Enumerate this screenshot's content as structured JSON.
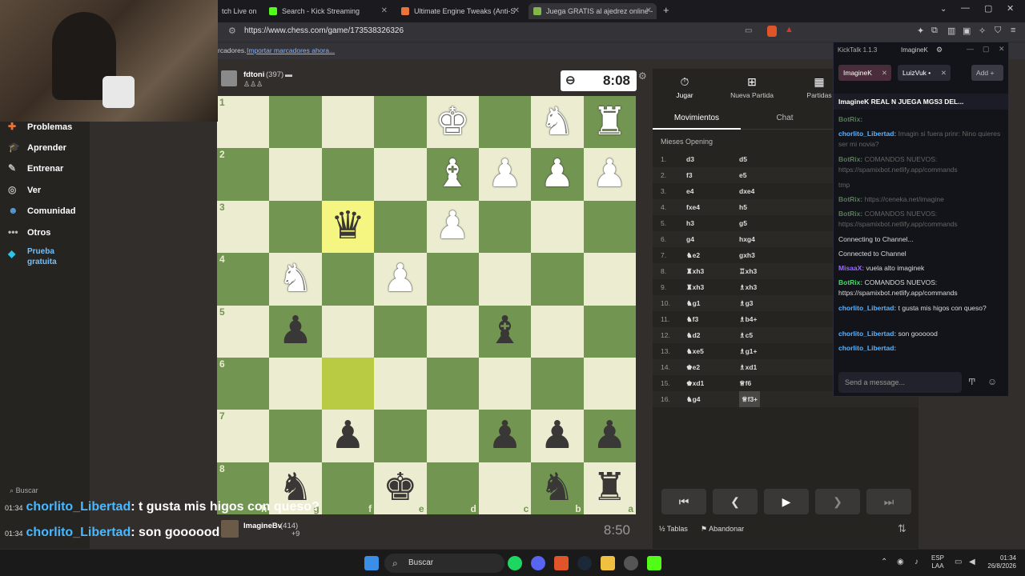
{
  "browser": {
    "tabs": [
      {
        "label": "tch Live on ",
        "active": false
      },
      {
        "label": "Search - Kick Streaming",
        "active": false
      },
      {
        "label": "Ultimate Engine Tweaks (Anti-Stutte",
        "active": false
      },
      {
        "label": "Juega GRATIS al ajedrez online -",
        "active": true
      }
    ],
    "url": "https://www.chess.com/game/173538326326",
    "bookmarks_prefix": "rcadores.",
    "bookmarks_link": "Importar marcadores ahora..."
  },
  "nav": {
    "items": [
      {
        "label": "Problemas",
        "icon": "puzzle-icon"
      },
      {
        "label": "Aprender",
        "icon": "learn-icon"
      },
      {
        "label": "Entrenar",
        "icon": "train-icon"
      },
      {
        "label": "Ver",
        "icon": "binoculars-icon"
      },
      {
        "label": "Comunidad",
        "icon": "community-icon"
      },
      {
        "label": "Otros",
        "icon": "more-icon"
      },
      {
        "label": "Prueba gratuita",
        "icon": "diamond-icon"
      }
    ],
    "search_label": "Buscar"
  },
  "game": {
    "top_player": {
      "name": "fdtoni",
      "rating": "(397)"
    },
    "top_clock": "8:08",
    "bottom_player": {
      "name": "ImagineBv",
      "rating": "(414)",
      "extra": "+9"
    },
    "bottom_clock": "8:50",
    "ranks": [
      "1",
      "2",
      "3",
      "4",
      "5",
      "6",
      "7",
      "8"
    ],
    "files": [
      "h",
      "g",
      "f",
      "e",
      "d",
      "c",
      "b",
      "a"
    ],
    "board": [
      [
        "",
        "",
        "",
        "",
        "wK",
        "",
        "wN",
        "wR"
      ],
      [
        "",
        "",
        "",
        "",
        "wB",
        "wP",
        "wP",
        "wP"
      ],
      [
        "",
        "",
        "bQ",
        "",
        "wP",
        "",
        "",
        ""
      ],
      [
        "",
        "wN",
        "",
        "wP",
        "",
        "",
        "",
        ""
      ],
      [
        "",
        "bP",
        "",
        "",
        "",
        "bB",
        "",
        ""
      ],
      [
        "",
        "",
        "",
        "",
        "",
        "",
        "",
        ""
      ],
      [
        "",
        "",
        "bP",
        "",
        "",
        "bP",
        "bP",
        "bP"
      ],
      [
        "",
        "bN",
        "",
        "bK",
        "",
        "",
        "bN",
        "bR"
      ]
    ]
  },
  "panel": {
    "top_buttons": [
      {
        "label": "Jugar",
        "icon": "stopwatch-icon"
      },
      {
        "label": "Nueva Partida",
        "icon": "plus-icon"
      },
      {
        "label": "Partidas",
        "icon": "board-icon"
      }
    ],
    "tabs": [
      "Movimientos",
      "Chat"
    ],
    "opening": "Mieses Opening",
    "moves": [
      {
        "n": "1.",
        "w": "d3",
        "b": "d5"
      },
      {
        "n": "2.",
        "w": "f3",
        "b": "e5"
      },
      {
        "n": "3.",
        "w": "e4",
        "b": "dxe4"
      },
      {
        "n": "4.",
        "w": "fxe4",
        "b": "h5"
      },
      {
        "n": "5.",
        "w": "h3",
        "b": "g5"
      },
      {
        "n": "6.",
        "w": "g4",
        "b": "hxg4"
      },
      {
        "n": "7.",
        "w": "♞e2",
        "b": "gxh3"
      },
      {
        "n": "8.",
        "w": "♜xh3",
        "b": "♖xh3"
      },
      {
        "n": "9.",
        "w": "♜xh3",
        "b": "♗xh3"
      },
      {
        "n": "10.",
        "w": "♞g1",
        "b": "♗g3"
      },
      {
        "n": "11.",
        "w": "♞f3",
        "b": "♗b4+"
      },
      {
        "n": "12.",
        "w": "♞d2",
        "b": "♗c5"
      },
      {
        "n": "13.",
        "w": "♞xe5",
        "b": "♗g1+"
      },
      {
        "n": "14.",
        "w": "♚e2",
        "b": "♗xd1"
      },
      {
        "n": "15.",
        "w": "♚xd1",
        "b": "♕f6"
      },
      {
        "n": "16.",
        "w": "♞g4",
        "b": "♕f3+"
      }
    ],
    "bottom_actions": [
      "Tablas",
      "Abandonar"
    ]
  },
  "kicktalk": {
    "title": "KickTalk 1.1.3",
    "user": "ImagineK",
    "channels": [
      "ImagineK",
      "LuizVuk •"
    ],
    "add_label": "Add",
    "header": "ImagineK   REAL N JUEGA MGS3 DEL...",
    "messages": [
      {
        "user": "BotRix:",
        "text": "",
        "dim": true
      },
      {
        "user": "chorlito_Libertad:",
        "text": "Imagin si fuera prinr: Nino quieres ser mi novia? ",
        "dim": true
      },
      {
        "user": "BotRix:",
        "text": "COMANDOS NUEVOS: https://spamixbot.netlify.app/commands",
        "dim": true
      },
      {
        "user": "",
        "text": "tmp",
        "dim": true
      },
      {
        "user": "BotRix:",
        "text": "https://ceneka.net/imagine",
        "dim": true
      },
      {
        "user": "BotRix:",
        "text": "COMANDOS NUEVOS: https://spamixbot.netlify.app/commands",
        "dim": true
      },
      {
        "user": "",
        "text": "Connecting to Channel...",
        "dim": false
      },
      {
        "user": "",
        "text": "Connected to Channel",
        "dim": false
      },
      {
        "user": "MisaaX:",
        "text": "vuela alto imaginek",
        "dim": false
      },
      {
        "user": "BotRix:",
        "text": "COMANDOS NUEVOS: https://spamixbot.netlify.app/commands",
        "dim": false
      },
      {
        "user": "chorlito_Libertad:",
        "text": "t gusta mis higos con queso?",
        "dim": false
      },
      {
        "user": "chorlito_Libertad:",
        "text": "son goooood",
        "dim": false
      },
      {
        "user": "chorlito_Libertad:",
        "text": "",
        "dim": false
      }
    ],
    "send_placeholder": "Send a message..."
  },
  "overlay": [
    {
      "time": "01:34",
      "user": "chorlito_Libertad",
      "text": ": t gusta mis higos con queso?"
    },
    {
      "time": "01:34",
      "user": "chorlito_Libertad",
      "text": ": son goooood"
    },
    {
      "time": "01:34",
      "user": "chorlito_Libertad",
      "text": ":"
    }
  ],
  "taskbar": {
    "search": "Buscar",
    "lang": "ESP",
    "lang2": "LAA",
    "time": "01:34",
    "date": "26/8/2026"
  }
}
